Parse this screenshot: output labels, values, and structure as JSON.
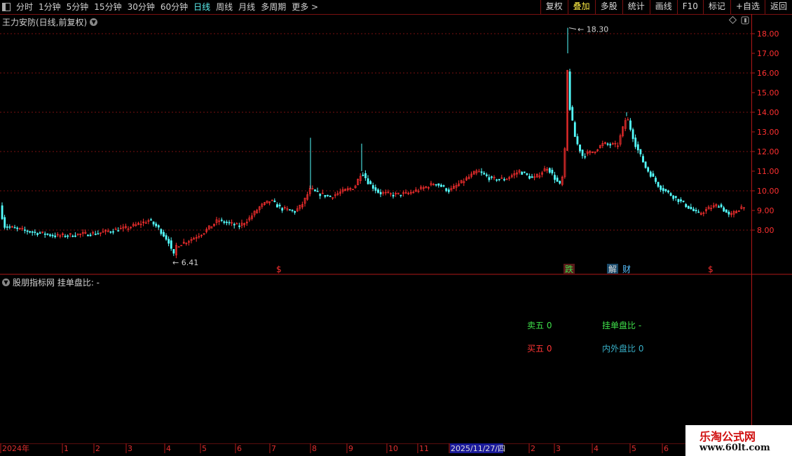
{
  "toolbar": {
    "periods": [
      "分时",
      "1分钟",
      "5分钟",
      "15分钟",
      "30分钟",
      "60分钟",
      "日线",
      "周线",
      "月线",
      "多周期",
      "更多 >"
    ],
    "active_period": "日线",
    "buttons": [
      "复权",
      "叠加",
      "多股",
      "统计",
      "画线",
      "F10",
      "标记",
      "+自选",
      "返回"
    ],
    "active_button": "叠加"
  },
  "chart_title": "王力安防(日线,前复权)",
  "indicator": {
    "title": "股朋指标网  挂单盘比: -",
    "sell5": "卖五 0",
    "buy5": "买五 0",
    "ratio": "挂单盘比 -",
    "inout": "内外盘比 0"
  },
  "price_axis": {
    "ticks": [
      "18.00",
      "17.00",
      "16.00",
      "15.00",
      "14.00",
      "13.00",
      "12.00",
      "11.00",
      "10.00",
      "9.00",
      "8.00"
    ]
  },
  "annotations": {
    "high": "18.30",
    "low": "6.41",
    "markers": [
      "$",
      "跌",
      "解",
      "财",
      "$"
    ]
  },
  "time_axis": {
    "labels": [
      "2024年",
      "1",
      "2",
      "3",
      "4",
      "5",
      "6",
      "7",
      "8",
      "9",
      "10",
      "11",
      "2025/11/27/四",
      "2",
      "3",
      "4",
      "5",
      "6"
    ]
  },
  "watermark": {
    "line1": "乐淘公式网",
    "line2": "www.60lt.com"
  },
  "colors": {
    "up": "#ff3030",
    "down": "#54ffff",
    "grid": "#7a1010",
    "active": "#5cf0f0",
    "active_button": "#ffee44"
  },
  "chart_data": {
    "type": "candlestick",
    "title": "王力安防(日线,前复权)",
    "ylim": [
      6.0,
      18.6
    ],
    "path": [
      [
        0,
        9.0
      ],
      [
        5,
        8.2
      ],
      [
        25,
        8.05
      ],
      [
        45,
        7.9
      ],
      [
        65,
        7.8
      ],
      [
        80,
        7.7
      ],
      [
        100,
        7.75
      ],
      [
        120,
        7.8
      ],
      [
        140,
        7.85
      ],
      [
        160,
        8.0
      ],
      [
        180,
        8.1
      ],
      [
        200,
        8.35
      ],
      [
        212,
        8.5
      ],
      [
        225,
        8.1
      ],
      [
        240,
        7.4
      ],
      [
        246,
        6.6
      ],
      [
        250,
        7.2
      ],
      [
        270,
        7.5
      ],
      [
        290,
        7.9
      ],
      [
        310,
        8.5
      ],
      [
        320,
        8.4
      ],
      [
        340,
        8.2
      ],
      [
        355,
        8.6
      ],
      [
        370,
        9.2
      ],
      [
        385,
        9.5
      ],
      [
        400,
        9.1
      ],
      [
        420,
        8.95
      ],
      [
        430,
        9.3
      ],
      [
        442,
        10.1
      ],
      [
        450,
        9.9
      ],
      [
        470,
        9.7
      ],
      [
        490,
        10.0
      ],
      [
        505,
        10.2
      ],
      [
        515,
        11.0
      ],
      [
        525,
        10.4
      ],
      [
        540,
        9.9
      ],
      [
        560,
        9.8
      ],
      [
        580,
        9.85
      ],
      [
        600,
        10.1
      ],
      [
        620,
        10.4
      ],
      [
        640,
        10.0
      ],
      [
        660,
        10.5
      ],
      [
        680,
        11.0
      ],
      [
        700,
        10.6
      ],
      [
        720,
        10.6
      ],
      [
        740,
        11.0
      ],
      [
        760,
        10.6
      ],
      [
        780,
        11.2
      ],
      [
        795,
        10.4
      ],
      [
        800,
        10.2
      ],
      [
        806,
        12.5
      ],
      [
        809,
        17.0
      ],
      [
        812,
        14.2
      ],
      [
        820,
        12.6
      ],
      [
        830,
        11.8
      ],
      [
        845,
        12.0
      ],
      [
        860,
        12.4
      ],
      [
        880,
        12.3
      ],
      [
        893,
        13.8
      ],
      [
        905,
        12.4
      ],
      [
        920,
        11.2
      ],
      [
        940,
        10.2
      ],
      [
        960,
        9.7
      ],
      [
        980,
        9.2
      ],
      [
        995,
        8.8
      ],
      [
        1010,
        9.1
      ],
      [
        1025,
        9.3
      ],
      [
        1040,
        8.7
      ],
      [
        1050,
        9.0
      ],
      [
        1062,
        9.3
      ]
    ],
    "spikes": [
      [
        442,
        12.7
      ],
      [
        515,
        12.4
      ],
      [
        809,
        18.3
      ],
      [
        893,
        14.0
      ]
    ],
    "high_label": 18.3,
    "low_label": 6.41
  }
}
